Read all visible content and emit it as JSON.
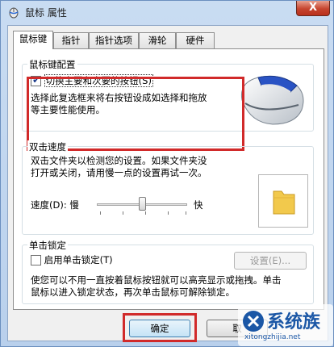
{
  "window": {
    "title": "鼠标 属性",
    "close_label": "X"
  },
  "tabs": [
    {
      "label": "鼠标键",
      "active": true
    },
    {
      "label": "指针",
      "active": false
    },
    {
      "label": "指针选项",
      "active": false
    },
    {
      "label": "滑轮",
      "active": false
    },
    {
      "label": "硬件",
      "active": false
    }
  ],
  "button_config": {
    "group_title": "鼠标键配置",
    "swap_checkbox_label": "切换主要和次要的按钮(S)",
    "swap_checked": true,
    "description_line1": "选择此复选框来将右按钮设成如选择和拖放",
    "description_line2": "等主要性能使用。"
  },
  "double_click": {
    "group_title": "双击速度",
    "description_line1": "双击文件夹以检测您的设置。如果文件夹没",
    "description_line2": "打开或关闭，请用慢一点的设置再试一次。",
    "speed_label": "速度(D): 慢",
    "fast_label": "快",
    "speed_fraction": 0.5
  },
  "click_lock": {
    "group_title": "单击锁定",
    "checkbox_label": "启用单击锁定(T)",
    "checked": false,
    "settings_button": "设置(E)...",
    "description_line1": "使您可以不用一直按着鼠标按钮就可以高亮显示或拖拽。单击",
    "description_line2": "鼠标以进入锁定状态，再次单击鼠标可解除锁定。"
  },
  "footer": {
    "ok_button": "确定",
    "next_button_partial": "取"
  },
  "watermark": {
    "brand": "系统族",
    "url": "xitongzhijia.net"
  },
  "colors": {
    "highlight_border": "#d12a2a",
    "folder": "#f2c94c"
  }
}
